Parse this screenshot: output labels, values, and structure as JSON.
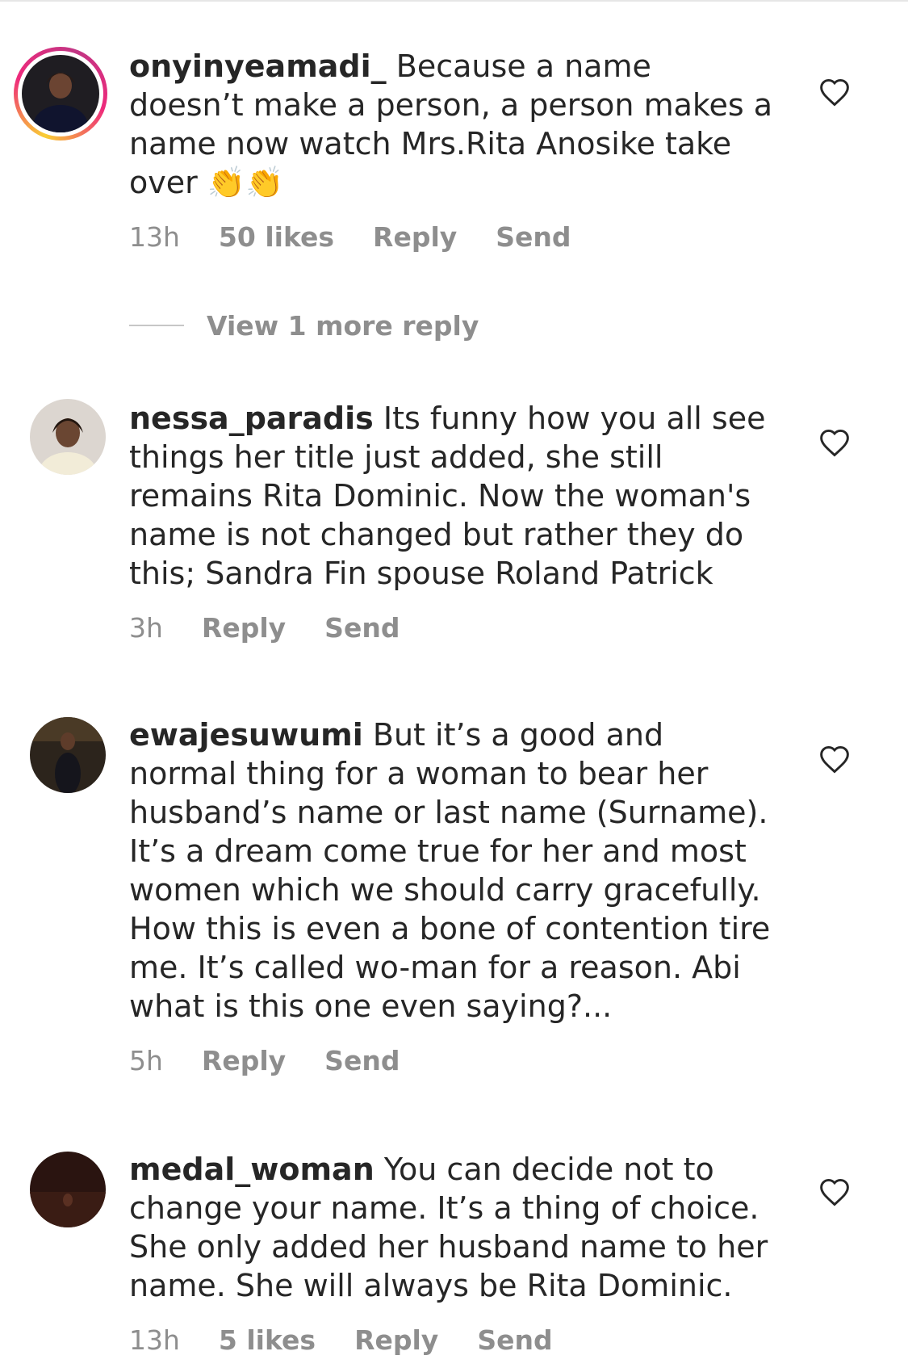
{
  "comments": [
    {
      "username": "onyinyeamadi_",
      "text": "Because a name doesn’t make a person, a person makes a name now watch Mrs.Rita Anosike take over 👏👏",
      "time": "13h",
      "likes": "50 likes",
      "reply_label": "Reply",
      "send_label": "Send",
      "has_story_ring": true
    },
    {
      "username": "nessa_paradis",
      "text": "Its funny how you all see things her title just added, she still remains Rita Dominic. Now the woman's name is not changed but rather they do this; Sandra Fin spouse Roland Patrick",
      "time": "3h",
      "reply_label": "Reply",
      "send_label": "Send"
    },
    {
      "username": "ewajesuwumi",
      "text": "But it’s a good and normal thing for a woman to bear her husband’s name or last name (Surname). It’s a dream come true for her and most women which we should carry gracefully. How this is even a bone of contention tire me. It’s called wo-man for a reason. Abi what is this one even saying?...",
      "time": "5h",
      "reply_label": "Reply",
      "send_label": "Send"
    },
    {
      "username": "medal_woman",
      "text": "You can decide not to change your name. It’s a thing of choice. She only added her husband name to her name. She will always be Rita Dominic.",
      "time": "13h",
      "likes": "5 likes",
      "reply_label": "Reply",
      "send_label": "Send"
    }
  ],
  "view_replies_label": "View 1 more reply",
  "icons": {
    "like": "heart-outline-icon"
  },
  "colors": {
    "text": "#262626",
    "secondary": "#8e8e8e"
  }
}
